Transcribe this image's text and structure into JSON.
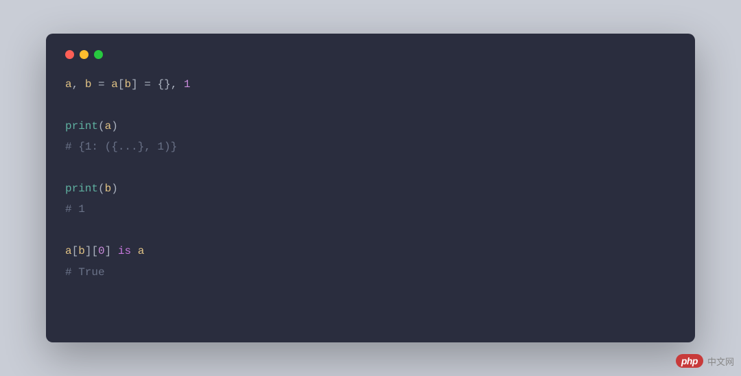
{
  "code": {
    "line1": {
      "a": "a",
      "comma1": ", ",
      "b": "b",
      "eq1": " = ",
      "a2": "a",
      "lb": "[",
      "b2": "b",
      "rb": "]",
      "eq2": " = ",
      "braces": "{}",
      "comma2": ", ",
      "one": "1"
    },
    "blank1": "",
    "line3": {
      "print": "print",
      "lp": "(",
      "a": "a",
      "rp": ")"
    },
    "line4": {
      "comment": "# {1: ({...}, 1)}"
    },
    "blank2": "",
    "line6": {
      "print": "print",
      "lp": "(",
      "b": "b",
      "rp": ")"
    },
    "line7": {
      "comment": "# 1"
    },
    "blank3": "",
    "line9": {
      "a": "a",
      "lb": "[",
      "b": "b",
      "rb": "]",
      "lb2": "[",
      "zero": "0",
      "rb2": "]",
      "sp1": " ",
      "is": "is",
      "sp2": " ",
      "a2": "a"
    },
    "line10": {
      "comment": "# True"
    }
  },
  "watermark": {
    "badge": "php",
    "text": "中文网"
  }
}
